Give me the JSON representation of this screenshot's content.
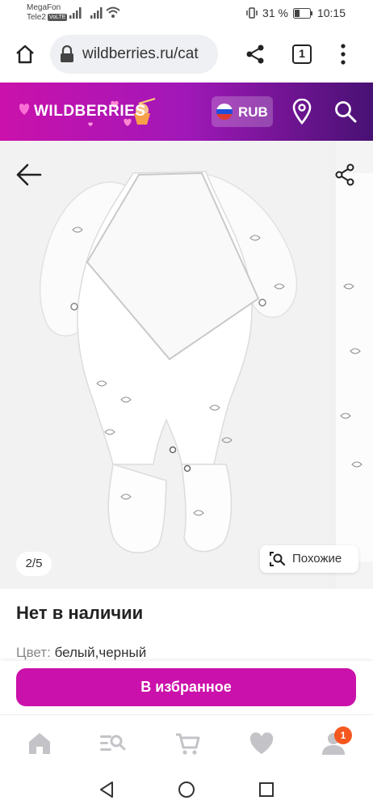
{
  "status_bar": {
    "carrier1": "MegaFon",
    "carrier2": "Tele2",
    "volte": "VoLTE",
    "battery": "31 %",
    "time": "10:15"
  },
  "browser": {
    "url": "wildberries.ru/cat",
    "tab_count": "1",
    "icons": [
      "home-icon",
      "lock-icon",
      "share-icon",
      "tabs-icon",
      "more-vert-icon"
    ]
  },
  "header": {
    "logo": "WILDBERRIES",
    "currency": "RUB",
    "icons": [
      "russia-flag-icon",
      "location-pin-icon",
      "search-icon"
    ],
    "colors": {
      "gradient_start": "#cb11ab",
      "gradient_end": "#481173"
    }
  },
  "gallery": {
    "counter": "2/5",
    "similar_label": "Похожие",
    "icons": [
      "back-arrow-icon",
      "share-icon",
      "similar-search-icon"
    ]
  },
  "product": {
    "availability": "Нет в наличии",
    "color_label": "Цвет:",
    "color_value": "белый,черный"
  },
  "actions": {
    "favorite_button": "В избранное",
    "accent": "#cb11ab"
  },
  "bottom_nav": {
    "items": [
      "home-icon",
      "catalog-search-icon",
      "cart-icon",
      "heart-icon",
      "profile-icon"
    ],
    "profile_badge": "1",
    "badge_color": "#f5571e"
  },
  "system_nav": {
    "icons": [
      "back-triangle-icon",
      "home-circle-icon",
      "recents-square-icon"
    ]
  }
}
